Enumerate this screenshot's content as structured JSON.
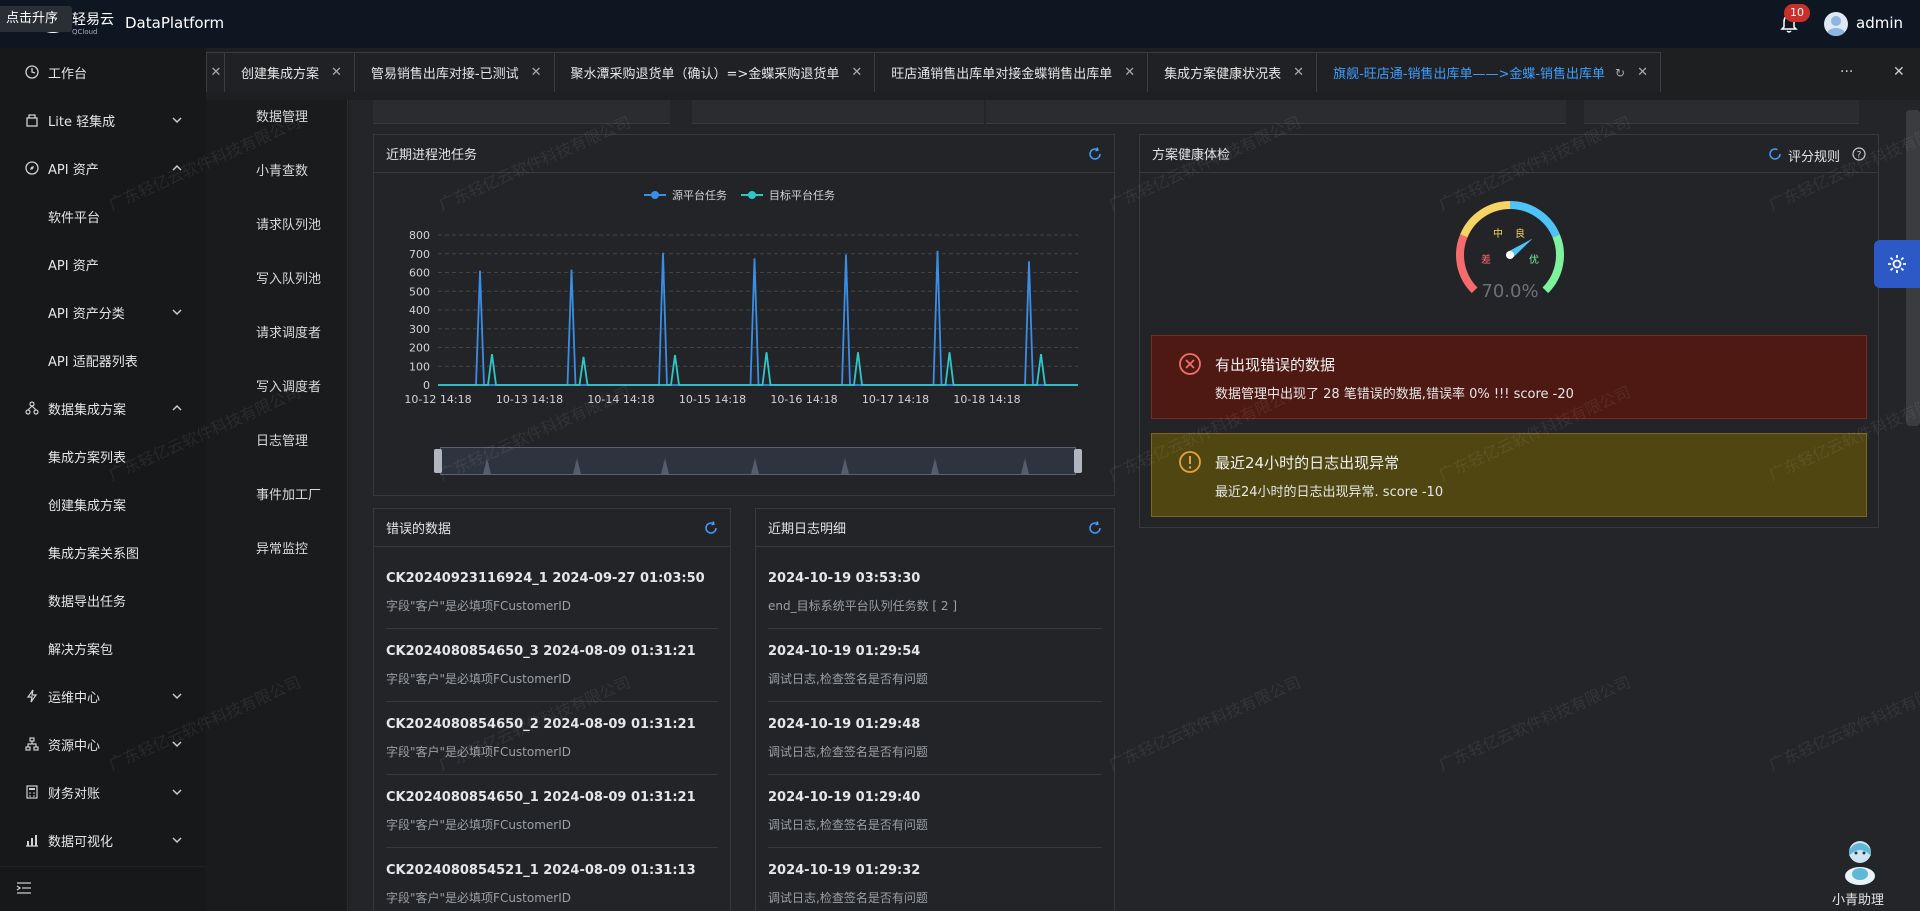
{
  "topbar": {
    "upgrade_label": "点击升序",
    "logo_text": "轻易云",
    "logo_sub": "QCloud",
    "app_title": "DataPlatform",
    "notification_count": "10",
    "username": "admin"
  },
  "sidebar": {
    "items": [
      {
        "label": "工作台",
        "icon": "clock-icon"
      },
      {
        "label": "Lite 轻集成",
        "icon": "lite-icon"
      },
      {
        "label": "API 资产",
        "icon": "compass-icon"
      },
      {
        "label": "软件平台"
      },
      {
        "label": "API 资产"
      },
      {
        "label": "API 资产分类"
      },
      {
        "label": "API 适配器列表"
      },
      {
        "label": "数据集成方案",
        "icon": "nodes-icon"
      },
      {
        "label": "集成方案列表"
      },
      {
        "label": "创建集成方案"
      },
      {
        "label": "集成方案关系图"
      },
      {
        "label": "数据导出任务"
      },
      {
        "label": "解决方案包"
      },
      {
        "label": "运维中心",
        "icon": "bolt-icon"
      },
      {
        "label": "资源中心",
        "icon": "hierarchy-icon"
      },
      {
        "label": "财务对账",
        "icon": "calculator-icon"
      },
      {
        "label": "数据可视化",
        "icon": "chart-icon"
      }
    ]
  },
  "submenu": {
    "items": [
      "数据管理",
      "小青查数",
      "请求队列池",
      "写入队列池",
      "请求调度者",
      "写入调度者",
      "日志管理",
      "事件加工厂",
      "异常监控"
    ]
  },
  "tabs": [
    {
      "label": "创建集成方案"
    },
    {
      "label": "管易销售出库对接-已测试"
    },
    {
      "label": "聚水潭采购退货单（确认）=>金蝶采购退货单"
    },
    {
      "label": "旺店通销售出库单对接金蝶销售出库单"
    },
    {
      "label": "集成方案健康状况表"
    },
    {
      "label": "旗舰-旺店通-销售出库单——>金蝶-销售出库单"
    }
  ],
  "tab_more": "···",
  "process_card": {
    "title": "近期进程池任务",
    "legend_source": "源平台任务",
    "legend_target": "目标平台任务"
  },
  "chart_data": {
    "type": "line",
    "x_ticks": [
      "10-12 14:18",
      "10-13 14:18",
      "10-14 14:18",
      "10-15 14:18",
      "10-16 14:18",
      "10-17 14:18",
      "10-18 14:18"
    ],
    "ylim": [
      0,
      800
    ],
    "y_ticks": [
      0,
      100,
      200,
      300,
      400,
      500,
      600,
      700,
      800
    ],
    "series": [
      {
        "name": "源平台任务",
        "color": "#3a8ee6",
        "spikes": [
          610,
          615,
          705,
          675,
          695,
          715,
          660
        ]
      },
      {
        "name": "目标平台任务",
        "color": "#2ec7c9",
        "spikes": [
          165,
          150,
          160,
          175,
          175,
          175,
          165
        ]
      }
    ]
  },
  "health_card": {
    "title": "方案健康体检",
    "rule_label": "评分规则",
    "gauge_value": "70.0%",
    "gauge_fraction": 0.7,
    "gauge_labels": {
      "bad": "差",
      "mid": "中",
      "good": "良",
      "excellent": "优"
    },
    "alerts": [
      {
        "title": "有出现错误的数据",
        "desc": "数据管理中出现了 28 笔错误的数据,错误率 0% !!! score -20",
        "type": "error",
        "color": "#5c1813"
      },
      {
        "title": "最近24小时的日志出现异常",
        "desc": "最近24小时的日志出现异常. score -10",
        "type": "warning",
        "color": "#5a4a0a"
      }
    ]
  },
  "errors_card": {
    "title": "错误的数据",
    "rows": [
      {
        "title": "CK20240923116924_1 2024-09-27 01:03:50",
        "desc": "字段\"客户\"是必填项FCustomerID"
      },
      {
        "title": "CK2024080854650_3 2024-08-09 01:31:21",
        "desc": "字段\"客户\"是必填项FCustomerID"
      },
      {
        "title": "CK2024080854650_2 2024-08-09 01:31:21",
        "desc": "字段\"客户\"是必填项FCustomerID"
      },
      {
        "title": "CK2024080854650_1 2024-08-09 01:31:21",
        "desc": "字段\"客户\"是必填项FCustomerID"
      },
      {
        "title": "CK2024080854521_1 2024-08-09 01:31:13",
        "desc": "字段\"客户\"是必填项FCustomerID"
      }
    ]
  },
  "logs_card": {
    "title": "近期日志明细",
    "rows": [
      {
        "title": "2024-10-19 03:53:30",
        "desc": "end_目标系统平台队列任务数 [ 2 ]"
      },
      {
        "title": "2024-10-19 01:29:54",
        "desc": "调试日志,检查签名是否有问题"
      },
      {
        "title": "2024-10-19 01:29:48",
        "desc": "调试日志,检查签名是否有问题"
      },
      {
        "title": "2024-10-19 01:29:40",
        "desc": "调试日志,检查签名是否有问题"
      },
      {
        "title": "2024-10-19 01:29:32",
        "desc": "调试日志,检查签名是否有问题"
      }
    ]
  },
  "assistant_label": "小青助理",
  "watermark_text": "广东轻亿云软件科技有限公司"
}
